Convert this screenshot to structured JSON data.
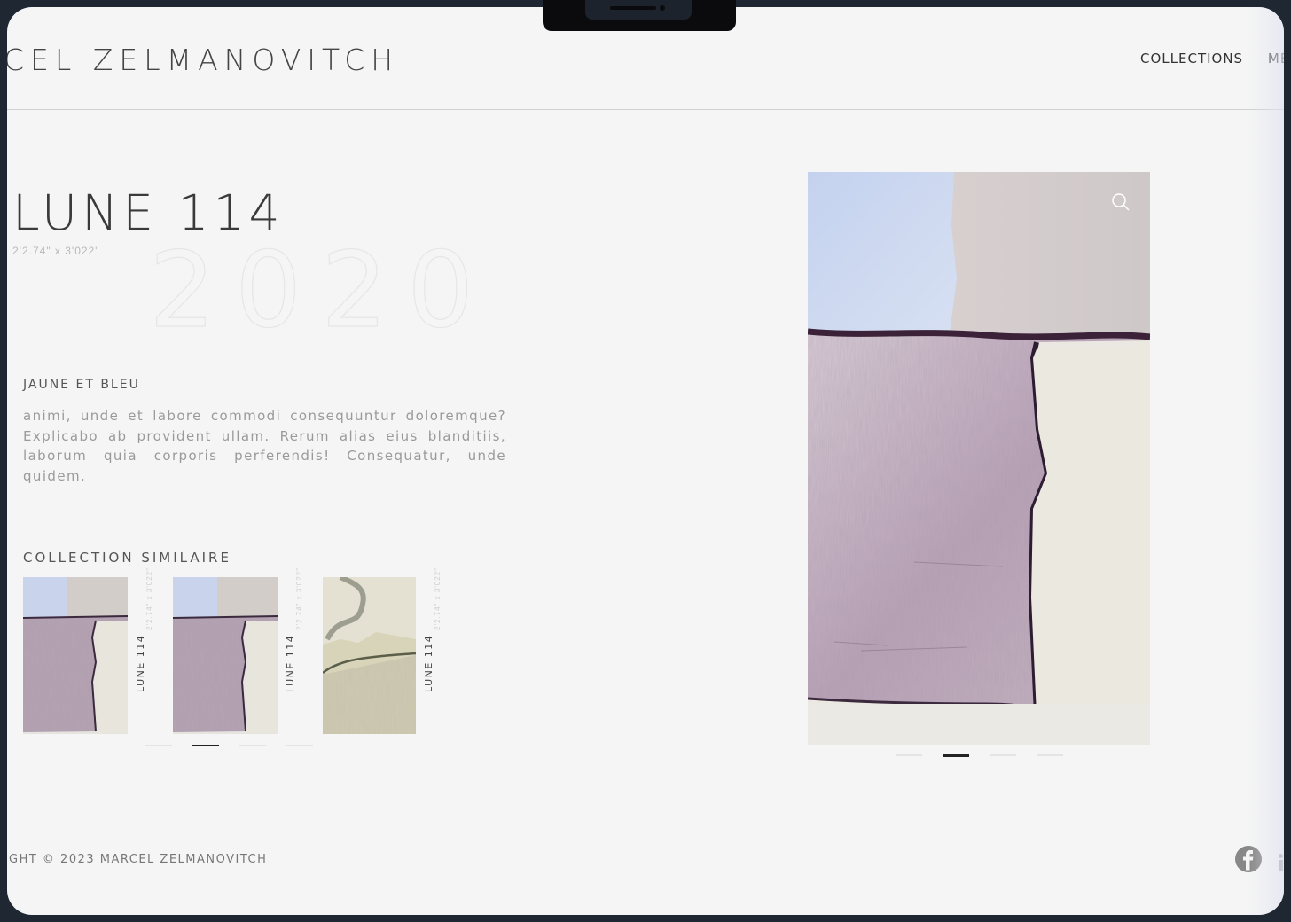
{
  "header": {
    "brand": "CEL ZELMANOVITCH",
    "nav": [
      "COLLECTIONS",
      "ME"
    ]
  },
  "artwork": {
    "title": "LUNE 114",
    "dimensions": "2'2.74\" x 3'022\"",
    "year": "2020",
    "subtitle": "JAUNE ET BLEU",
    "description": "animi, unde et labore commodi consequuntur doloremque? Explicabo ab provident ullam. Rerum alias eius blanditiis, laborum quia corporis perferendis! Consequatur, unde quidem."
  },
  "similar": {
    "heading": "COLLECTION SIMILAIRE",
    "items": [
      {
        "name": "LUNE 114",
        "dimensions": "2'2.74\" x 3'022\""
      },
      {
        "name": "LUNE 114",
        "dimensions": "2'2.74\" x 3'022\""
      },
      {
        "name": "LUNE 114",
        "dimensions": "2'2.74\" x 3'022\""
      }
    ],
    "pager": {
      "count": 4,
      "active_index": 1
    }
  },
  "gallery": {
    "pager": {
      "count": 4,
      "active_index": 1
    }
  },
  "footer": {
    "copyright": "GHT © 2023 MARCEL ZELMANOVITCH"
  },
  "icons": {
    "zoom": "search-icon",
    "facebook": "facebook-icon",
    "instagram": "instagram-icon"
  },
  "colors": {
    "background": "#f5f5f5",
    "text": "#3a3a3a",
    "muted": "#9a9a9a",
    "frame": "#1f2733",
    "pager_active": "#222222"
  }
}
